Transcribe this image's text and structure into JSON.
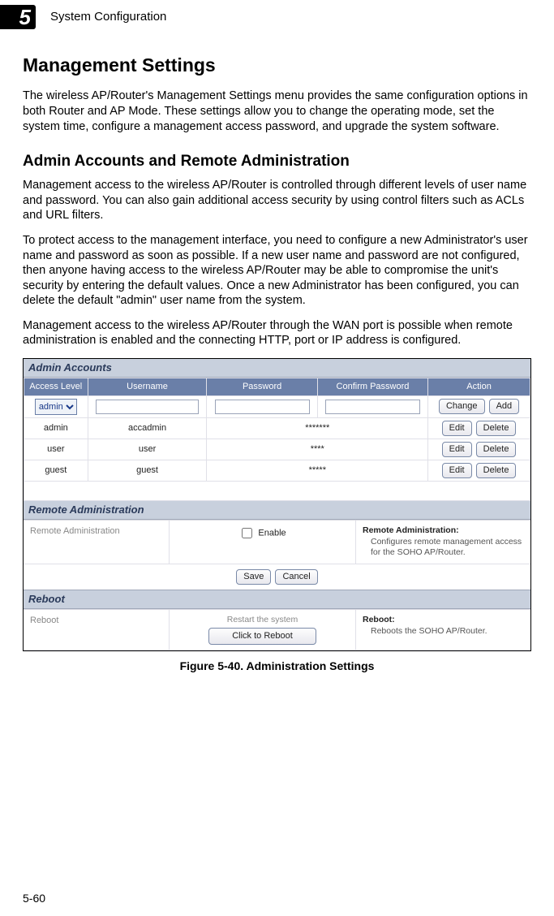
{
  "chapter_number": "5",
  "chapter_title": "System Configuration",
  "page_number": "5-60",
  "h1": "Management Settings",
  "p1": "The wireless AP/Router's Management Settings menu provides the same configuration options in both Router and AP Mode. These settings allow you to change the operating mode, set the system time, configure a management access password, and upgrade the system software.",
  "h2": "Admin Accounts and Remote Administration",
  "p2": "Management access to the wireless AP/Router is controlled through different levels of user name and password. You can also gain additional access security by using control filters such as ACLs and URL filters.",
  "p3": "To protect access to the management interface, you need to configure a new Administrator's user name and password as soon as possible. If a new user name and password are not configured, then anyone having access to the wireless AP/Router may be able to compromise the unit's security by entering the default values. Once a new Administrator has been configured, you can delete the default \"admin\" user name from the system.",
  "p4": "Management access to the wireless AP/Router through the WAN port is possible when remote administration is enabled and the connecting HTTP, port or IP address is configured.",
  "figure_caption": "Figure 5-40.   Administration Settings",
  "panel": {
    "admin_accounts_title": "Admin Accounts",
    "headers": {
      "level": "Access Level",
      "user": "Username",
      "pw": "Password",
      "cpw": "Confirm Password",
      "action": "Action"
    },
    "new_row": {
      "level_selected": "admin",
      "change": "Change",
      "add": "Add"
    },
    "rows": [
      {
        "level": "admin",
        "user": "accadmin",
        "pw": "*******",
        "edit": "Edit",
        "delete": "Delete"
      },
      {
        "level": "user",
        "user": "user",
        "pw": "****",
        "edit": "Edit",
        "delete": "Delete"
      },
      {
        "level": "guest",
        "user": "guest",
        "pw": "*****",
        "edit": "Edit",
        "delete": "Delete"
      }
    ],
    "remote_admin_title": "Remote Administration",
    "remote_admin_label": "Remote Administration",
    "enable_label": "Enable",
    "ra_help_title": "Remote Administration:",
    "ra_help_text": "Configures remote management access for the SOHO AP/Router.",
    "save": "Save",
    "cancel": "Cancel",
    "reboot_title": "Reboot",
    "reboot_label": "Reboot",
    "reboot_sub": "Restart the system",
    "reboot_button": "Click to Reboot",
    "reboot_help_title": "Reboot:",
    "reboot_help_text": "Reboots the SOHO AP/Router."
  }
}
